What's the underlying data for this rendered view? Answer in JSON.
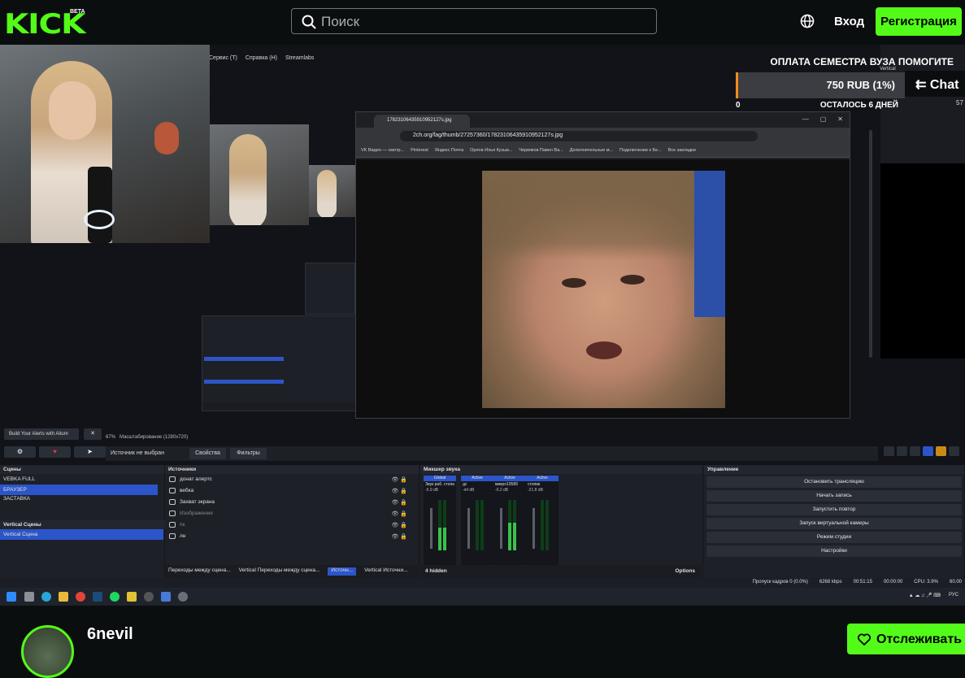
{
  "header": {
    "logo": "KICK",
    "beta": "BETA",
    "search_placeholder": "Поиск",
    "login": "Вход",
    "signup": "Регистрация"
  },
  "stream": {
    "obs_menu": [
      "Сервис (T)",
      "Справка (H)",
      "Streamlabs"
    ],
    "donation": {
      "title": "ОПЛАТА СЕМЕСТРА ВУЗА ПОМОГИТЕ",
      "amount": "750 RUB (1%)",
      "start": "0",
      "remaining": "ОСТАЛОСЬ 6 ДНЕЙ",
      "progress_percent": 1
    },
    "chat_button": "Chat",
    "right_vertical_label": "Vertical",
    "right_number": "57",
    "browser": {
      "tab_title": "1782310643591095​2127s.jpg",
      "url": "2ch.org/fag/thumb/27257360/17823106435910952127s.jpg",
      "bookmarks": [
        "VK Видео — смотр...",
        "Pinterest",
        "Яндекс Почта",
        "Орлов Илья Кузьм...",
        "Червяков Павел Ва...",
        "Дополнительные м...",
        "Подключение к Бе...",
        "Все закладки"
      ]
    },
    "alerts_button": "Build Your Alerts with Aitum",
    "preview_zoom": "67%",
    "preview_res": "Масштабирование (1280x720)",
    "no_source": "Источник не выбран",
    "properties": "Свойства",
    "filters": "Фильтры",
    "scenes": {
      "title": "Сцены",
      "items": [
        "VEBKA FULL",
        "БРАУЗЕР",
        "ЗАСТАВКА"
      ],
      "selected_index": 1,
      "vertical_title": "Vertical Сцены",
      "vertical_items": [
        "Vertical Сцена"
      ]
    },
    "sources": {
      "title": "Источники",
      "items": [
        "донат алертс",
        "вебка",
        "Захват экрана",
        "Изображение",
        "пк",
        "лн"
      ],
      "tabs": [
        "Переходы между сцена...",
        "Vertical Переходы между сцена...",
        "Источн...",
        "Vertical Источни..."
      ],
      "active_tab": 2
    },
    "mixer": {
      "title": "Микшер звука",
      "channels": [
        {
          "label": "Global",
          "name": "Звук раб. стола",
          "db": "-5.9 dB",
          "level": 0.45
        },
        {
          "label": "Active",
          "name": "дс",
          "db": "-inf dB",
          "level": 0.0
        },
        {
          "label": "Active",
          "name": "микро10589",
          "db": "-0.2 dB",
          "level": 0.55
        },
        {
          "label": "Active",
          "name": "стопик",
          "db": "-21.8 dB",
          "level": 0.0
        }
      ],
      "hidden": "4 hidden",
      "options": "Options"
    },
    "controls": {
      "title": "Управление",
      "buttons": [
        "Остановить трансляцию",
        "Начать запись",
        "Запустить повтор",
        "Запуск виртуальной камеры",
        "Режим студии",
        "Настройки"
      ]
    },
    "statusbar": {
      "dropped": "Пропуск кадров 0 (0.0%)",
      "bitrate": "6268 kbps",
      "live_time": "00:51:15",
      "rec_time": "00:00:00",
      "cpu": "CPU: 3.9%",
      "fps": "60.00"
    },
    "tray_lang": "РУС"
  },
  "channel": {
    "name": "6nevil",
    "follow": "Отслеживать"
  },
  "colors": {
    "brand": "#53fc18",
    "obs_accent": "#2c55c9",
    "donation_bar": "#f28c1b"
  }
}
